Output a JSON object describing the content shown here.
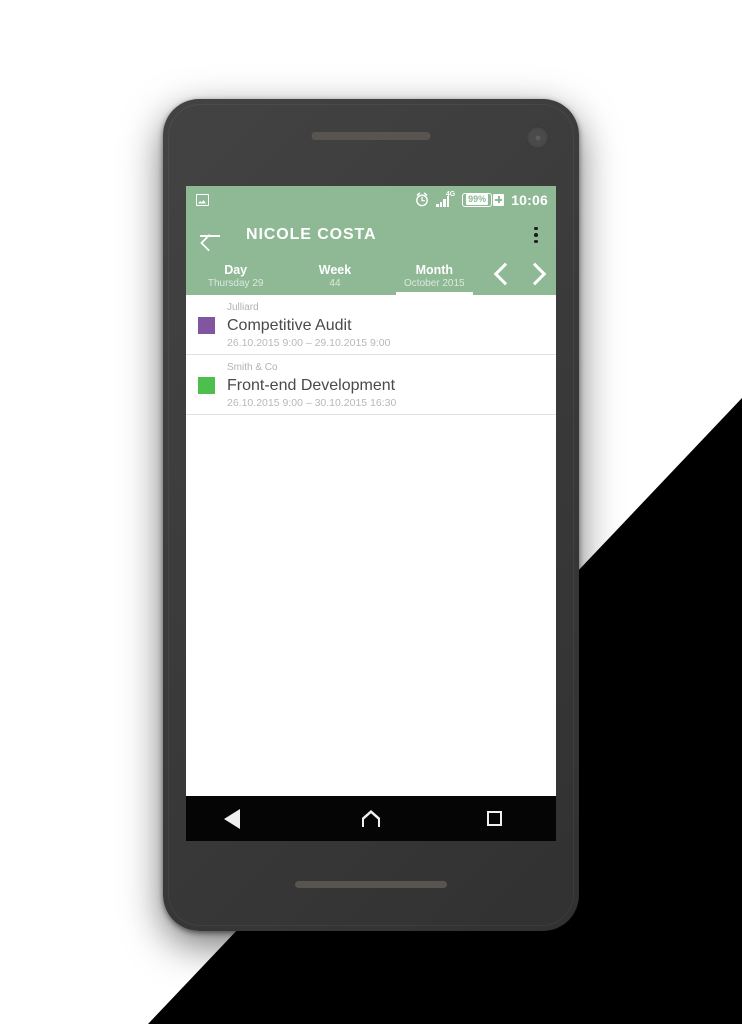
{
  "theme": {
    "accent_green": "#8FB894",
    "nav_bar_bg": "#050505",
    "screen_bg": "#FFFFFF"
  },
  "status_bar": {
    "notification_icon": "image-notification-icon",
    "alarm_icon": "alarm-clock-icon",
    "network_type": "4G",
    "signal_icon": "signal-bars-icon",
    "battery_percent": "99%",
    "battery_charging_icon": "battery-charging-plus-icon",
    "time": "10:06"
  },
  "app_bar": {
    "back_icon": "back-arrow-icon",
    "title": "NICOLE COSTA",
    "overflow_icon": "overflow-menu-icon"
  },
  "tabs": [
    {
      "label": "Day",
      "sub": "Thursday 29",
      "active": false
    },
    {
      "label": "Week",
      "sub": "44",
      "active": false
    },
    {
      "label": "Month",
      "sub": "October 2015",
      "active": true
    }
  ],
  "period_nav": {
    "prev_icon": "chevron-left-icon",
    "next_icon": "chevron-right-icon"
  },
  "events": [
    {
      "client": "Julliard",
      "title": "Competitive Audit",
      "range": "26.10.2015 9:00 – 29.10.2015 9:00",
      "color": "#8255A0"
    },
    {
      "client": "Smith & Co",
      "title": "Front-end Development",
      "range": "26.10.2015 9:00 – 30.10.2015 16:30",
      "color": "#4CBF4C"
    }
  ],
  "nav_bar": {
    "back_icon": "nav-back-triangle-icon",
    "home_icon": "nav-home-icon",
    "recents_icon": "nav-recents-square-icon"
  }
}
